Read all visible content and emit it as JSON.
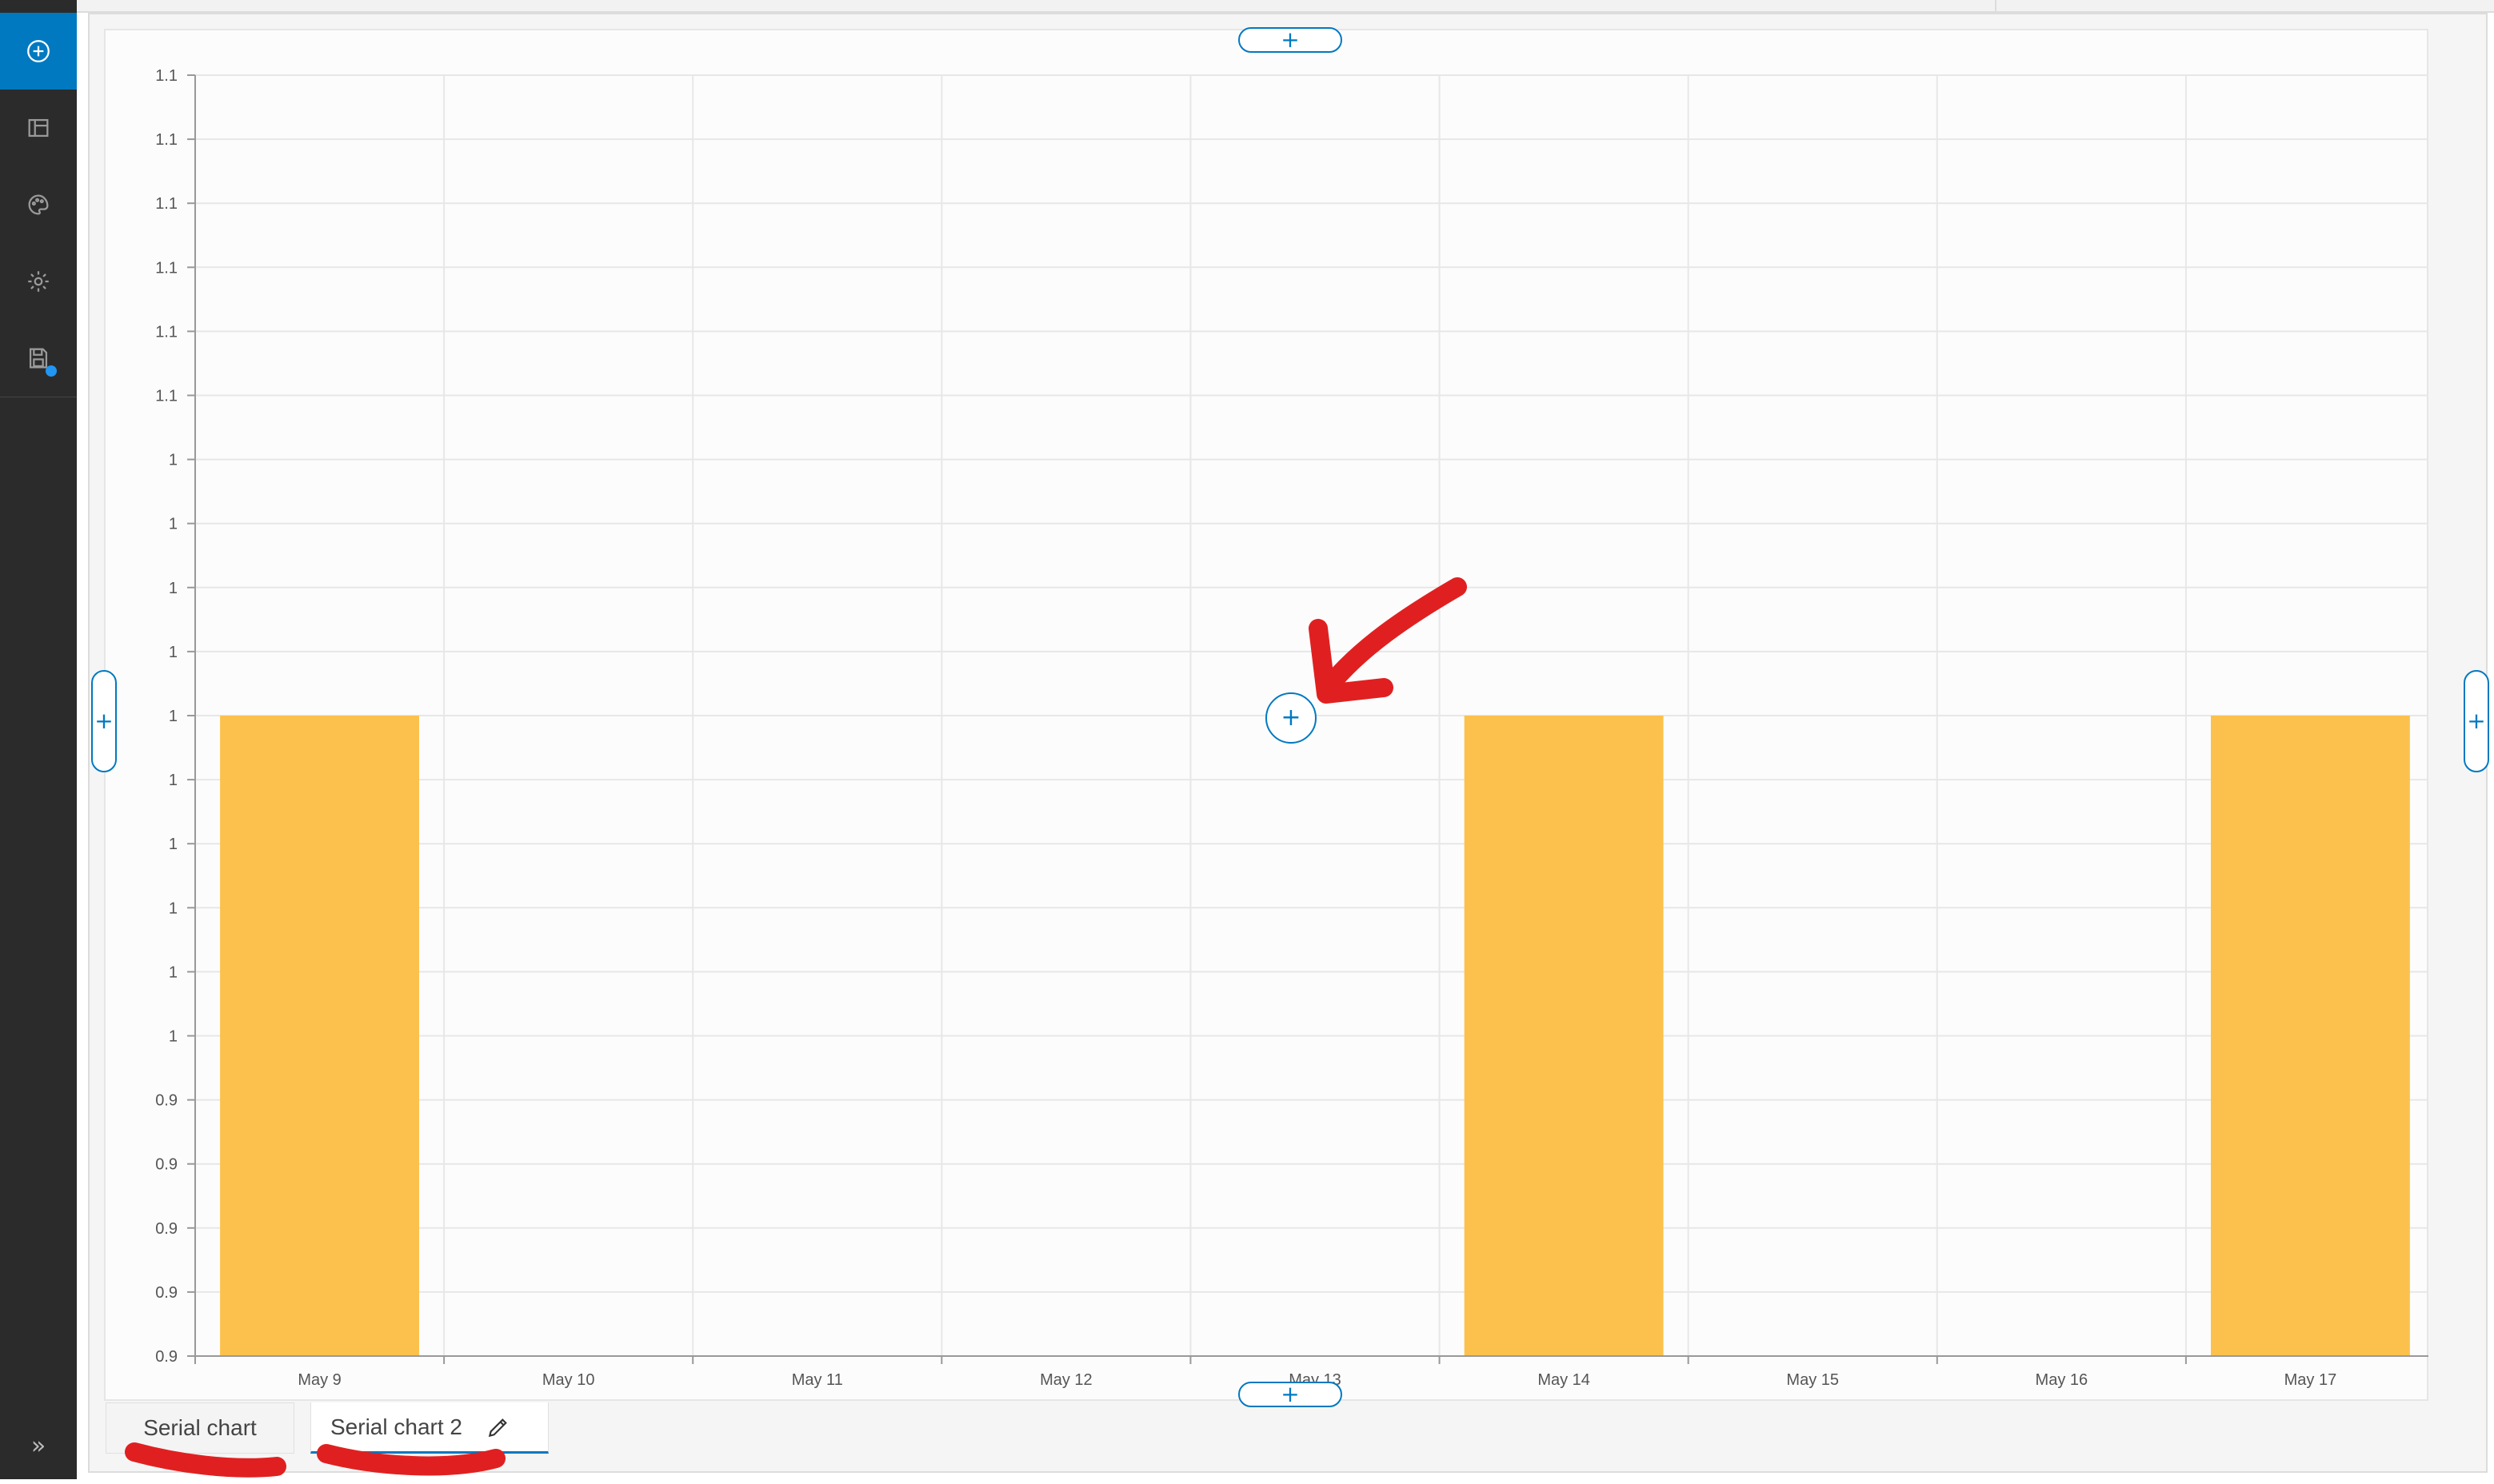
{
  "colors": {
    "accent": "#0079c1",
    "bar": "#fcc14c",
    "sidebar": "#2b2b2b",
    "annotation": "#e02020"
  },
  "sidebar": {
    "items": [
      {
        "icon": "add-circle-icon",
        "active": true
      },
      {
        "icon": "layout-icon"
      },
      {
        "icon": "palette-icon"
      },
      {
        "icon": "gear-icon"
      },
      {
        "icon": "save-icon",
        "badge": "unsaved-dot"
      }
    ],
    "expand_label": "»"
  },
  "handles": {
    "top": "+",
    "bottom": "+",
    "left": "+",
    "right": "+",
    "center": "+"
  },
  "chart_data": {
    "type": "bar",
    "categories": [
      "May 9",
      "May 10",
      "May 11",
      "May 12",
      "May 13",
      "May 14",
      "May 15",
      "May 16",
      "May 17"
    ],
    "values": [
      1,
      null,
      null,
      null,
      null,
      1,
      null,
      null,
      1
    ],
    "ylim": [
      0.9,
      1.1
    ],
    "y_tick_labels": [
      "1.1",
      "1.1",
      "1.1",
      "1.1",
      "1.1",
      "1.1",
      "1",
      "1",
      "1",
      "1",
      "1",
      "1",
      "1",
      "1",
      "1",
      "1",
      "0.9",
      "0.9",
      "0.9",
      "0.9",
      "0.9"
    ],
    "grid": true,
    "bar_color": "#fcc14c"
  },
  "tabs": [
    {
      "label": "Serial chart"
    },
    {
      "label": "Serial chart 2",
      "active": true,
      "edit_icon": "pencil-icon"
    }
  ]
}
